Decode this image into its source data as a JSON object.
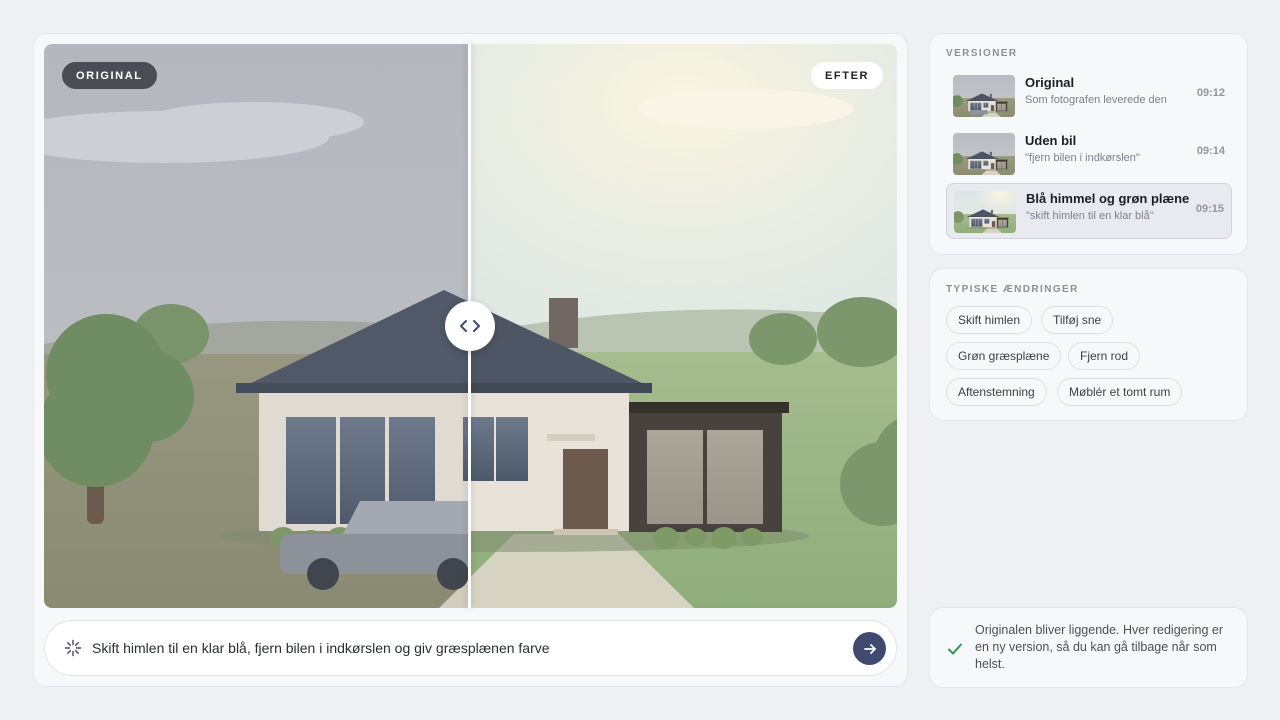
{
  "compare": {
    "before_label": "ORIGINAL",
    "after_label": "EFTER"
  },
  "prompt": {
    "value": "Skift himlen til en klar blå, fjern bilen i indkørslen og giv græsplænen farve",
    "icon": "sparkle-icon",
    "send_icon": "arrow-right-icon"
  },
  "versions": {
    "title": "VERSIONER",
    "items": [
      {
        "title": "Original",
        "subtitle": "Som fotografen leverede den",
        "time": "09:12"
      },
      {
        "title": "Uden bil",
        "subtitle": "\"fjern bilen i indkørslen\"",
        "time": "09:14"
      },
      {
        "title": "Blå himmel og grøn plæne",
        "subtitle": "\"skift himlen til en klar blå\"",
        "time": "09:15"
      }
    ]
  },
  "changes": {
    "title": "TYPISKE ÆNDRINGER",
    "chips": [
      "Skift himlen",
      "Tilføj sne",
      "Grøn græsplæne",
      "Fjern rod",
      "Aftenstemning",
      "Møblér et tomt rum"
    ]
  },
  "note": {
    "text": "Originalen bliver liggende. Hver redigering er en ny version, så du kan gå tilbage når som helst.",
    "icon": "check-icon"
  },
  "colors": {
    "accent": "#3e4a70",
    "success": "#2e9a4a"
  }
}
